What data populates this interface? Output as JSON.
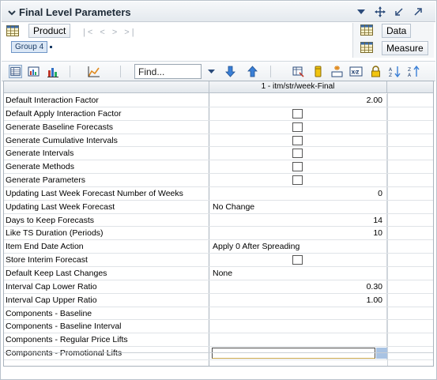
{
  "panel": {
    "title": "Final Level Parameters"
  },
  "pivot": {
    "row_dimension": "Product",
    "group_label": "Group 4",
    "nav_arrows": "|< < > >|",
    "right_dimensions": [
      "Data",
      "Measure"
    ]
  },
  "toolbar": {
    "find_placeholder": "Find..."
  },
  "grid": {
    "column_header": "1 - itm/str/week-Final",
    "rows": [
      {
        "label": "Default Interaction Factor",
        "type": "num",
        "value": "2.00"
      },
      {
        "label": "Default Apply Interaction Factor",
        "type": "check",
        "value": ""
      },
      {
        "label": "Generate Baseline Forecasts",
        "type": "check",
        "value": ""
      },
      {
        "label": "Generate Cumulative Intervals",
        "type": "check",
        "value": ""
      },
      {
        "label": "Generate Intervals",
        "type": "check",
        "value": ""
      },
      {
        "label": "Generate Methods",
        "type": "check",
        "value": ""
      },
      {
        "label": "Generate Parameters",
        "type": "check",
        "value": ""
      },
      {
        "label": "Updating Last Week Forecast Number of Weeks",
        "type": "num",
        "value": "0"
      },
      {
        "label": "Updating Last Week Forecast",
        "type": "txt",
        "value": "No Change"
      },
      {
        "label": "Days to Keep Forecasts",
        "type": "num",
        "value": "14"
      },
      {
        "label": "Like TS Duration (Periods)",
        "type": "num",
        "value": "10"
      },
      {
        "label": "Item End Date Action",
        "type": "txt",
        "value": "Apply 0 After Spreading"
      },
      {
        "label": "Store Interim Forecast",
        "type": "check",
        "value": ""
      },
      {
        "label": "Default Keep Last Changes",
        "type": "txt",
        "value": "None"
      },
      {
        "label": "Interval Cap Lower Ratio",
        "type": "num",
        "value": "0.30"
      },
      {
        "label": "Interval Cap Upper Ratio",
        "type": "num",
        "value": "1.00"
      },
      {
        "label": "Components - Baseline",
        "type": "txt",
        "value": ""
      },
      {
        "label": "Components - Baseline Interval",
        "type": "txt",
        "value": ""
      },
      {
        "label": "Components - Regular Price Lifts",
        "type": "txt",
        "value": ""
      },
      {
        "label": "Components - Promotional Lifts",
        "type": "edit",
        "value": ""
      }
    ]
  },
  "colors": {
    "accent_blue": "#2f6fc4",
    "header_bg": "#e4e9ee",
    "edit_highlight": "#a9c3e3"
  }
}
